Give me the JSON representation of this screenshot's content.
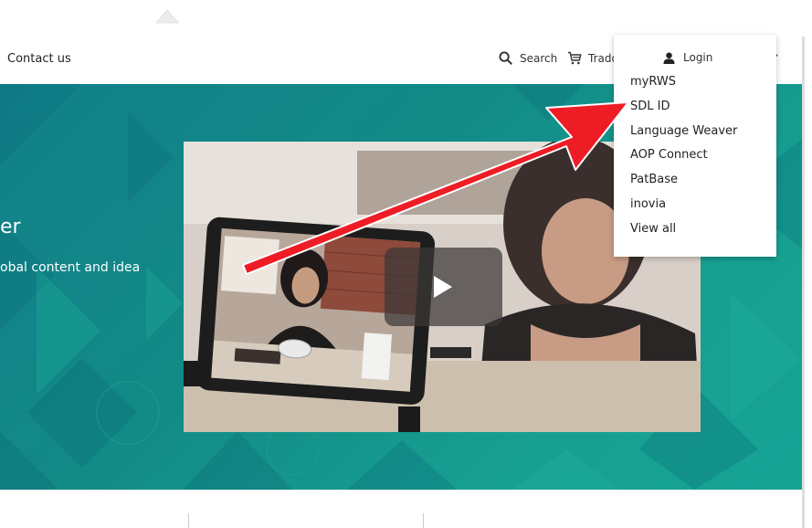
{
  "header": {
    "contact_label": "Contact us",
    "search_label": "Search",
    "trados_label": "Trado"
  },
  "login_menu": {
    "login_label": "Login",
    "items": [
      {
        "label": "myRWS"
      },
      {
        "label": "SDL ID"
      },
      {
        "label": "Language Weaver"
      },
      {
        "label": "AOP Connect"
      },
      {
        "label": "PatBase"
      },
      {
        "label": "inovia"
      },
      {
        "label": "View all"
      }
    ]
  },
  "hero": {
    "title_fragment": "er",
    "subtitle_fragment": "obal content and idea"
  },
  "colors": {
    "hero_teal": "#12808a",
    "annotation_arrow": "#ee1c25"
  },
  "icons": {
    "search": "search-icon",
    "cart": "cart-icon",
    "user": "user-icon",
    "chevron": "chevron-down-icon",
    "play": "play-icon"
  }
}
